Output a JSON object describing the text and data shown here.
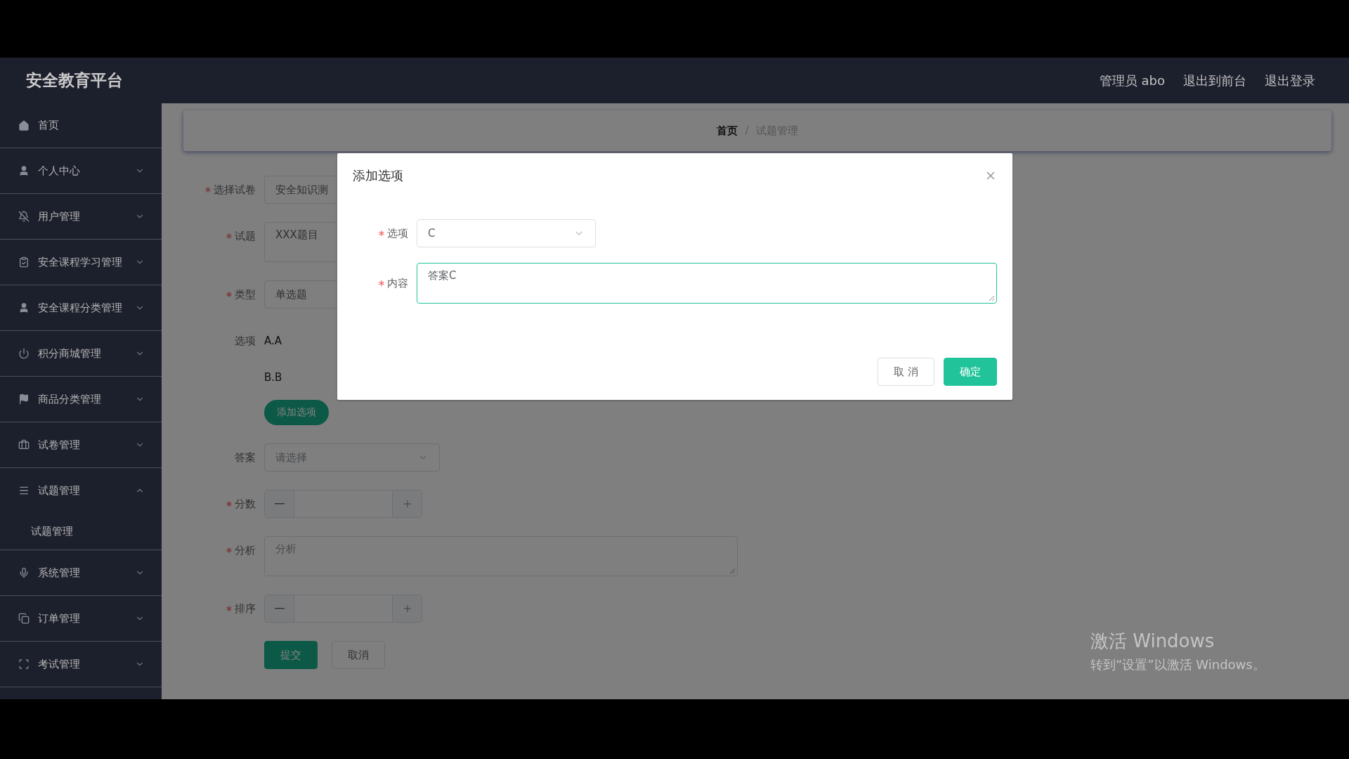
{
  "header": {
    "title": "安全教育平台",
    "links": [
      "管理员 abo",
      "退出到前台",
      "退出登录"
    ]
  },
  "sidebar": {
    "items": [
      {
        "label": "首页",
        "kind": "link"
      },
      {
        "label": "个人中心",
        "kind": "submenu",
        "expanded": false
      },
      {
        "label": "用户管理",
        "kind": "submenu",
        "expanded": false
      },
      {
        "label": "安全课程学习管理",
        "kind": "submenu",
        "expanded": false
      },
      {
        "label": "安全课程分类管理",
        "kind": "submenu",
        "expanded": false
      },
      {
        "label": "积分商城管理",
        "kind": "submenu",
        "expanded": false
      },
      {
        "label": "商品分类管理",
        "kind": "submenu",
        "expanded": false
      },
      {
        "label": "试卷管理",
        "kind": "submenu",
        "expanded": false
      },
      {
        "label": "试题管理",
        "kind": "submenu",
        "expanded": true,
        "children": [
          {
            "label": "试题管理"
          }
        ]
      },
      {
        "label": "系统管理",
        "kind": "submenu",
        "expanded": false
      },
      {
        "label": "订单管理",
        "kind": "submenu",
        "expanded": false
      },
      {
        "label": "考试管理",
        "kind": "submenu",
        "expanded": false
      }
    ]
  },
  "breadcrumb": {
    "items": [
      "首页",
      "试题管理"
    ],
    "separator": "/"
  },
  "form": {
    "fields": [
      {
        "label": "选择试卷",
        "required": true,
        "kind": "select",
        "value": "安全知识测",
        "covered": true
      },
      {
        "label": "试题",
        "required": true,
        "kind": "textarea",
        "value": "XXX题目",
        "covered": true
      },
      {
        "label": "类型",
        "required": true,
        "kind": "select",
        "value": "单选题",
        "covered": true
      },
      {
        "label": "选项",
        "required": false,
        "kind": "options",
        "options": [
          "A.A",
          "B.B"
        ],
        "add_button": "添加选项"
      },
      {
        "label": "答案",
        "required": false,
        "kind": "select",
        "placeholder": "请选择"
      },
      {
        "label": "分数",
        "required": true,
        "kind": "number"
      },
      {
        "label": "分析",
        "required": true,
        "kind": "textarea",
        "placeholder": "分析"
      },
      {
        "label": "排序",
        "required": true,
        "kind": "number"
      }
    ],
    "buttons": [
      {
        "label": "提交",
        "kind": "primary"
      },
      {
        "label": "取消",
        "kind": "default"
      }
    ]
  },
  "dialog": {
    "title": "添加选项",
    "fields": [
      {
        "label": "选项",
        "required": true,
        "kind": "select",
        "value": "C",
        "focused": false
      },
      {
        "label": "内容",
        "required": true,
        "kind": "textarea",
        "value": "答案C",
        "focused": true
      }
    ],
    "buttons": [
      {
        "label": "取 消",
        "kind": "default"
      },
      {
        "label": "确定",
        "kind": "primary"
      }
    ]
  },
  "os_notice": {
    "title": "激活 Windows",
    "text": "转到“设置”以激活 Windows。"
  }
}
